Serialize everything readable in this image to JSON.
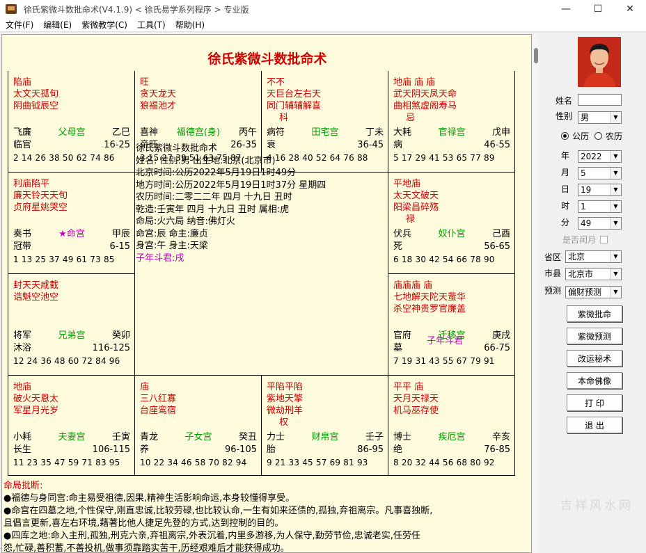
{
  "window": {
    "title": "徐氏紫微斗数批命术(V4.1.9)  < 徐氏易学系列程序 >  专业版",
    "minimize": "—",
    "maximize": "☐",
    "close": "✕"
  },
  "menu": [
    "文件(F)",
    "编辑(E)",
    "紫微教学(C)",
    "工具(T)",
    "帮助(H)"
  ],
  "chart_title": "徐氏紫微斗数批命术",
  "palaces": {
    "p0": {
      "lines": [
        [
          "陷庙"
        ],
        [
          "太文天孤旬"
        ],
        [
          "阴曲钺辰空"
        ]
      ],
      "god": "飞廉",
      "name": "父母宫",
      "branch": "乙巳",
      "stage": "临官",
      "range": "16-25",
      "ages": "2 14 26 38 50 62 74 86"
    },
    "p1": {
      "lines": [
        [
          "旺"
        ],
        [
          "贪天龙天"
        ],
        [
          "狼福池才"
        ]
      ],
      "god": "喜神",
      "name": "福德宫(身)",
      "branch": "丙午",
      "stage": "帝旺",
      "range": "26-35",
      "ages": "3 15 27 39 51 63 75 87"
    },
    "p2": {
      "lines": [
        [
          "不不"
        ],
        [
          "天巨台左右天"
        ],
        [
          "同门辅辅解喜"
        ],
        [
          "科"
        ]
      ],
      "god": "病符",
      "name": "田宅宫",
      "branch": "丁未",
      "stage": "衰",
      "range": "36-45",
      "ages": "4 16 28 40 52 64 76 88"
    },
    "p3": {
      "lines": [
        [
          "地庙  庙   庙"
        ],
        [
          "武天阴天凤天命"
        ],
        [
          "曲相煞虚阁寿马"
        ],
        [
          "忌"
        ]
      ],
      "god": "大耗",
      "name": "官禄宫",
      "branch": "戊申",
      "stage": "病",
      "range": "46-55",
      "ages": "5 17 29 41 53 65 77 89"
    },
    "p4": {
      "lines": [
        [
          "利庙陷平"
        ],
        [
          "廉天铃天天旬"
        ],
        [
          "贞府星姚哭空"
        ]
      ],
      "god": "奏书",
      "name": "★命宫",
      "branch": "甲辰",
      "stage": "冠带",
      "range": "6-15",
      "ages": "1 13 25 37 49 61 73 85"
    },
    "p5": {
      "lines": [
        [
          "平地庙"
        ],
        [
          "太天文破天"
        ],
        [
          "阳梁昌碎殇"
        ],
        [
          "禄"
        ]
      ],
      "god": "伏兵",
      "name": "奴仆宫",
      "branch": "己酉",
      "stage": "死",
      "range": "56-65",
      "ages": "6 18 30 42 54 66 78 90"
    },
    "p6": {
      "lines": [
        [
          "封天天咸截"
        ],
        [
          "诰魁空池空"
        ]
      ],
      "god": "将军",
      "name": "兄弟宫",
      "branch": "癸卯",
      "stage": "沐浴",
      "range": "116-125",
      "ages": "12 24 36 48 60 72 84 96"
    },
    "p7": {
      "lines": [
        [
          "庙庙庙  庙"
        ],
        [
          "七地解天陀天蜚华"
        ],
        [
          "杀空神贵罗官廉盖"
        ]
      ],
      "god": "官府",
      "name": "迁移宫",
      "branch": "庚戌",
      "stage": "墓",
      "range": "66-75",
      "ages": "7 19 31 43 55 67 79 91",
      "extra": "子年斗君"
    },
    "p8": {
      "lines": [
        [
          "地庙"
        ],
        [
          "破火天恩太"
        ],
        [
          "军星月光岁"
        ]
      ],
      "god": "小耗",
      "name": "夫妻宫",
      "branch": "壬寅",
      "stage": "长生",
      "range": "106-115",
      "ages": "11 23 35 47 59 71 83 95"
    },
    "p9": {
      "lines": [
        [
          "  庙"
        ],
        [
          "三八红寡"
        ],
        [
          "台座鸾宿"
        ]
      ],
      "god": "青龙",
      "name": "子女宫",
      "branch": "癸丑",
      "stage": "养",
      "range": "96-105",
      "ages": "10 22 34 46 58 70 82 94"
    },
    "p10": {
      "lines": [
        [
          "平陷平陷"
        ],
        [
          "紫地天擎"
        ],
        [
          "微劫刑羊"
        ],
        [
          "权"
        ]
      ],
      "god": "力士",
      "name": "财帛宫",
      "branch": "壬子",
      "stage": "胎",
      "range": "86-95",
      "ages": "9 21 33 45 57 69 81 93"
    },
    "p11": {
      "lines": [
        [
          "平平  庙"
        ],
        [
          "天月天禄天"
        ],
        [
          "机马巫存使"
        ]
      ],
      "god": "博士",
      "name": "疾厄宫",
      "branch": "辛亥",
      "stage": "绝",
      "range": "76-85",
      "ages": "8 20 32 44 56 68 80 92"
    }
  },
  "center": {
    "lines": [
      "徐氏紫微斗数批命术",
      "姓名:  性别:男  出生地:北京(北京市)",
      "北京时间:公历2022年5月19日1时49分",
      "地方时间:公历2022年5月19日1时37分 星期四",
      "农历时间:二零二二年 四月 十九日 丑时",
      "乾造:壬寅年 四月 十九日 丑时 属相:虎",
      "命局:火六局  纳音:佛灯火",
      "命宫:辰  命主:廉贞",
      "身宫:午  身主:天梁"
    ],
    "dou": "子年斗君:戌"
  },
  "analysis": {
    "head": "命局批断:",
    "lines": [
      "●福德与身同宫:命主易受祖德,因果,精神生活影响命运,本身较懂得享受。",
      "●命宫在四墓之地,个性保守,刚直忠诚,比较劳碌,也比较认命,一生有如来还债的,孤独,弃祖离宗。凡事喜独断,",
      "且倡言更新,喜左右环境,藉著比他人捷足先登的方式,达到控制的目的。",
      "●四库之地:命入主刑,孤独,刑克六亲,弃祖离宗,外表沉着,内里多游移,为人保守,勤劳节俭,忠诚老实,任劳任",
      "怨,忙碌,善积蓄,不善投机,做事须靠踏实苦干,历经艰难后才能获得成功。"
    ]
  },
  "side": {
    "name_label": "姓名",
    "name_value": "",
    "gender_label": "性别",
    "gender_value": "男",
    "calendar_solar": "公历",
    "calendar_lunar": "农历",
    "year_label": "年",
    "year_value": "2022",
    "month_label": "月",
    "month_value": "5",
    "day_label": "日",
    "day_value": "19",
    "hour_label": "时",
    "hour_value": "1",
    "minute_label": "分",
    "minute_value": "49",
    "leap_label": "是否闰月",
    "province_label": "省区",
    "province_value": "北京",
    "city_label": "市县",
    "city_value": "北京市",
    "forecast_label": "预测",
    "forecast_value": "偏财预测",
    "buttons": [
      "紫微批命",
      "紫微预测",
      "改运秘术",
      "本命佛像",
      "打 印",
      "退 出"
    ]
  },
  "watermark": "吉祥风水网",
  "colors": {
    "star_main": "#d00000",
    "star_aux": "#0000cc",
    "palace_name": "#00a000",
    "ming": "#c000c0",
    "bg": "#fffbdc"
  }
}
